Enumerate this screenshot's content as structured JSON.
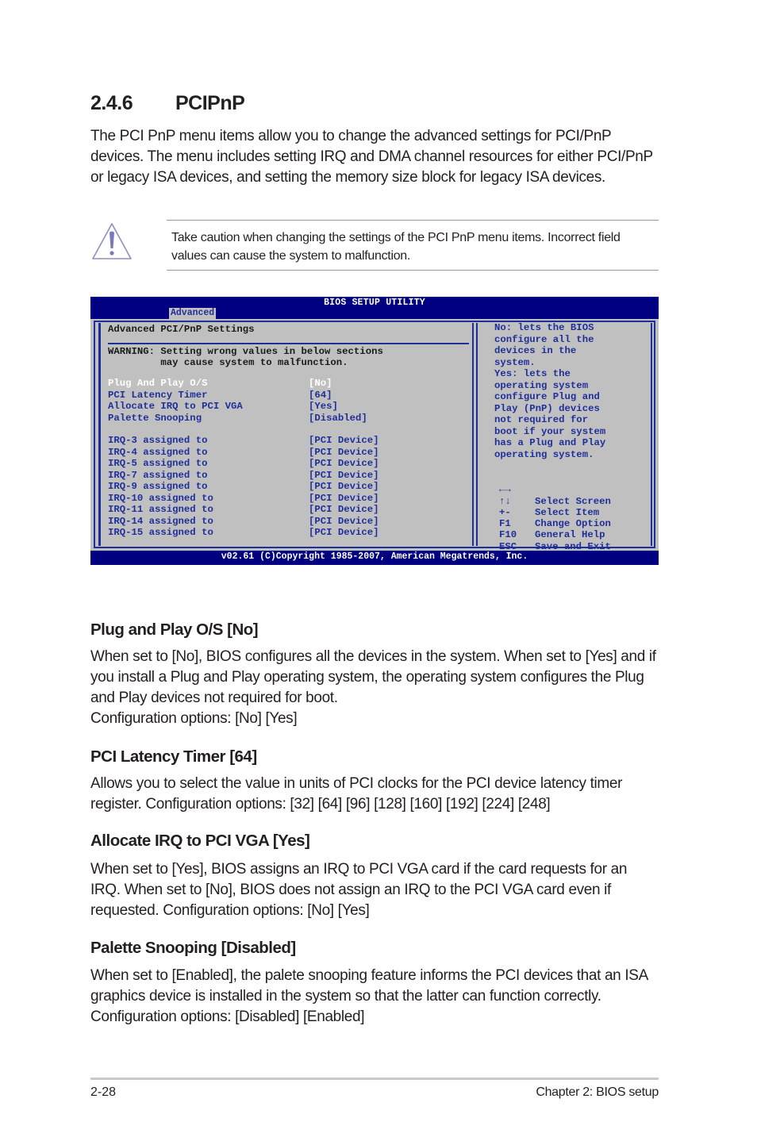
{
  "section": {
    "number": "2.4.6",
    "title": "PCIPnP",
    "intro": "The PCI PnP menu items allow you to change the advanced settings for PCI/PnP devices. The menu includes setting IRQ and DMA channel resources for either PCI/PnP or legacy ISA devices, and setting the memory size block for legacy ISA devices."
  },
  "caution": {
    "icon": "warning-triangle-icon",
    "text": "Take caution when changing the settings of the PCI PnP menu items. Incorrect field values can cause the system to malfunction."
  },
  "bios": {
    "title": "BIOS SETUP UTILITY",
    "active_tab": "Advanced",
    "panel_title": "Advanced PCI/PnP Settings",
    "warning_line1": "WARNING: Setting wrong values in below sections",
    "warning_line2": "         may cause system to malfunction.",
    "settings": [
      {
        "label": "Plug And Play O/S",
        "value": "[No]",
        "selected": true
      },
      {
        "label": "PCI Latency Timer",
        "value": "[64]"
      },
      {
        "label": "Allocate IRQ to PCI VGA",
        "value": "[Yes]"
      },
      {
        "label": "Palette Snooping",
        "value": "[Disabled]"
      }
    ],
    "irq_settings": [
      {
        "label": "IRQ-3 assigned to",
        "value": "[PCI Device]"
      },
      {
        "label": "IRQ-4 assigned to",
        "value": "[PCI Device]"
      },
      {
        "label": "IRQ-5 assigned to",
        "value": "[PCI Device]"
      },
      {
        "label": "IRQ-7 assigned to",
        "value": "[PCI Device]"
      },
      {
        "label": "IRQ-9 assigned to",
        "value": "[PCI Device]"
      },
      {
        "label": "IRQ-10 assigned to",
        "value": "[PCI Device]"
      },
      {
        "label": "IRQ-11 assigned to",
        "value": "[PCI Device]"
      },
      {
        "label": "IRQ-14 assigned to",
        "value": "[PCI Device]"
      },
      {
        "label": "IRQ-15 assigned to",
        "value": "[PCI Device]"
      }
    ],
    "help_text": "No: lets the BIOS\nconfigure all the\ndevices in the\nsystem.\nYes: lets the\noperating system\nconfigure Plug and\nPlay (PnP) devices\nnot required for\nboot if your system\nhas a Plug and Play\noperating system.",
    "keys": [
      {
        "key": "←→",
        "icon": "left-right-arrows-icon",
        "label": "Select Screen"
      },
      {
        "key": "↑↓",
        "icon": "up-down-arrows-icon",
        "label": "Select Item"
      },
      {
        "key": "+-",
        "label": "Change Option"
      },
      {
        "key": "F1",
        "label": "General Help"
      },
      {
        "key": "F10",
        "label": "Save and Exit"
      },
      {
        "key": "ESC",
        "label": "Exit"
      }
    ],
    "footer": "v02.61 (C)Copyright 1985-2007, American Megatrends, Inc.",
    "colors": {
      "title_bar": "#000080",
      "background": "#c0c0c0",
      "text": "#1f2f9a",
      "selected": "#ffffff"
    }
  },
  "subsections": [
    {
      "heading": "Plug and Play O/S [No]",
      "body": "When set to [No], BIOS configures all the devices in the system. When set to [Yes] and if you install a Plug and Play operating system, the operating system configures the Plug and Play devices not required for boot.",
      "options": "Configuration options: [No] [Yes]"
    },
    {
      "heading": "PCI Latency Timer [64]",
      "body": "Allows you to select the value in units of PCI clocks for the PCI device latency timer register. Configuration options: [32] [64] [96] [128] [160] [192] [224] [248]"
    },
    {
      "heading": "Allocate IRQ to PCI VGA [Yes]",
      "body": "When set to [Yes], BIOS assigns an IRQ to PCI VGA card if the card requests for an IRQ. When set to [No], BIOS does not assign an IRQ to the PCI VGA card even if requested. Configuration options: [No] [Yes]"
    },
    {
      "heading": "Palette Snooping [Disabled]",
      "body": "When set to [Enabled], the palete snooping feature informs the PCI devices that an ISA graphics device is installed in the system so that the latter can function correctly. Configuration options: [Disabled] [Enabled]"
    }
  ],
  "footer": {
    "page_number": "2-28",
    "chapter": "Chapter 2: BIOS setup"
  }
}
